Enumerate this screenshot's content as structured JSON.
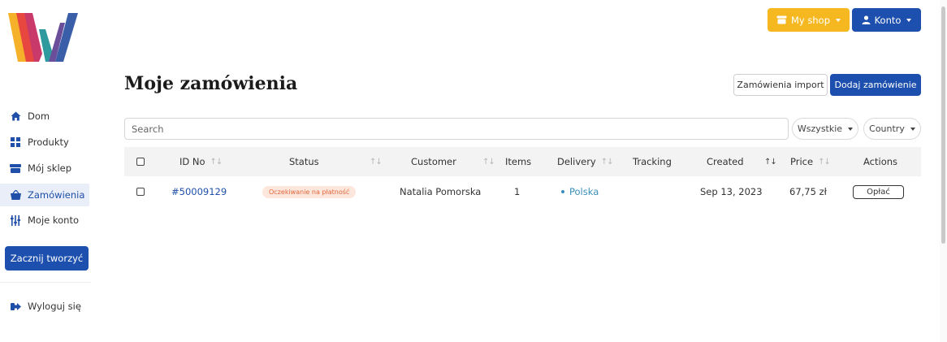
{
  "header": {
    "title": "Moje zamówienia",
    "myshop_label": "My shop",
    "konto_label": "Konto",
    "import_label": "Zamówienia import",
    "add_label": "Dodaj zamówienie"
  },
  "sidebar": {
    "items": [
      {
        "label": "Dom",
        "icon": "home-icon"
      },
      {
        "label": "Produkty",
        "icon": "grid-icon"
      },
      {
        "label": "Mój sklep",
        "icon": "store-icon"
      },
      {
        "label": "Zamówienia",
        "icon": "basket-icon",
        "active": true
      },
      {
        "label": "Moje konto",
        "icon": "sliders-icon"
      }
    ],
    "create_label": "Zacznij tworzyć",
    "logout_label": "Wyloguj się"
  },
  "filters": {
    "search_placeholder": "Search",
    "status_filter": "Wszystkie",
    "country_filter": "Country"
  },
  "table": {
    "columns": [
      "ID No",
      "Status",
      "Customer",
      "Items",
      "Delivery",
      "Tracking",
      "Created",
      "Price",
      "Actions"
    ],
    "rows": [
      {
        "id": "#50009129",
        "status": "Oczekiwanie na płatność",
        "customer": "Natalia Pomorska",
        "items": "1",
        "delivery": "Polska",
        "tracking": "",
        "created": "Sep 13, 2023",
        "price": "67,75 zł",
        "action": "Opłać"
      }
    ]
  },
  "colors": {
    "primary": "#1d4fae",
    "accent": "#f6b820",
    "status_bg": "#fde6dc",
    "status_text": "#e2673d",
    "link": "#1f4fa8"
  }
}
